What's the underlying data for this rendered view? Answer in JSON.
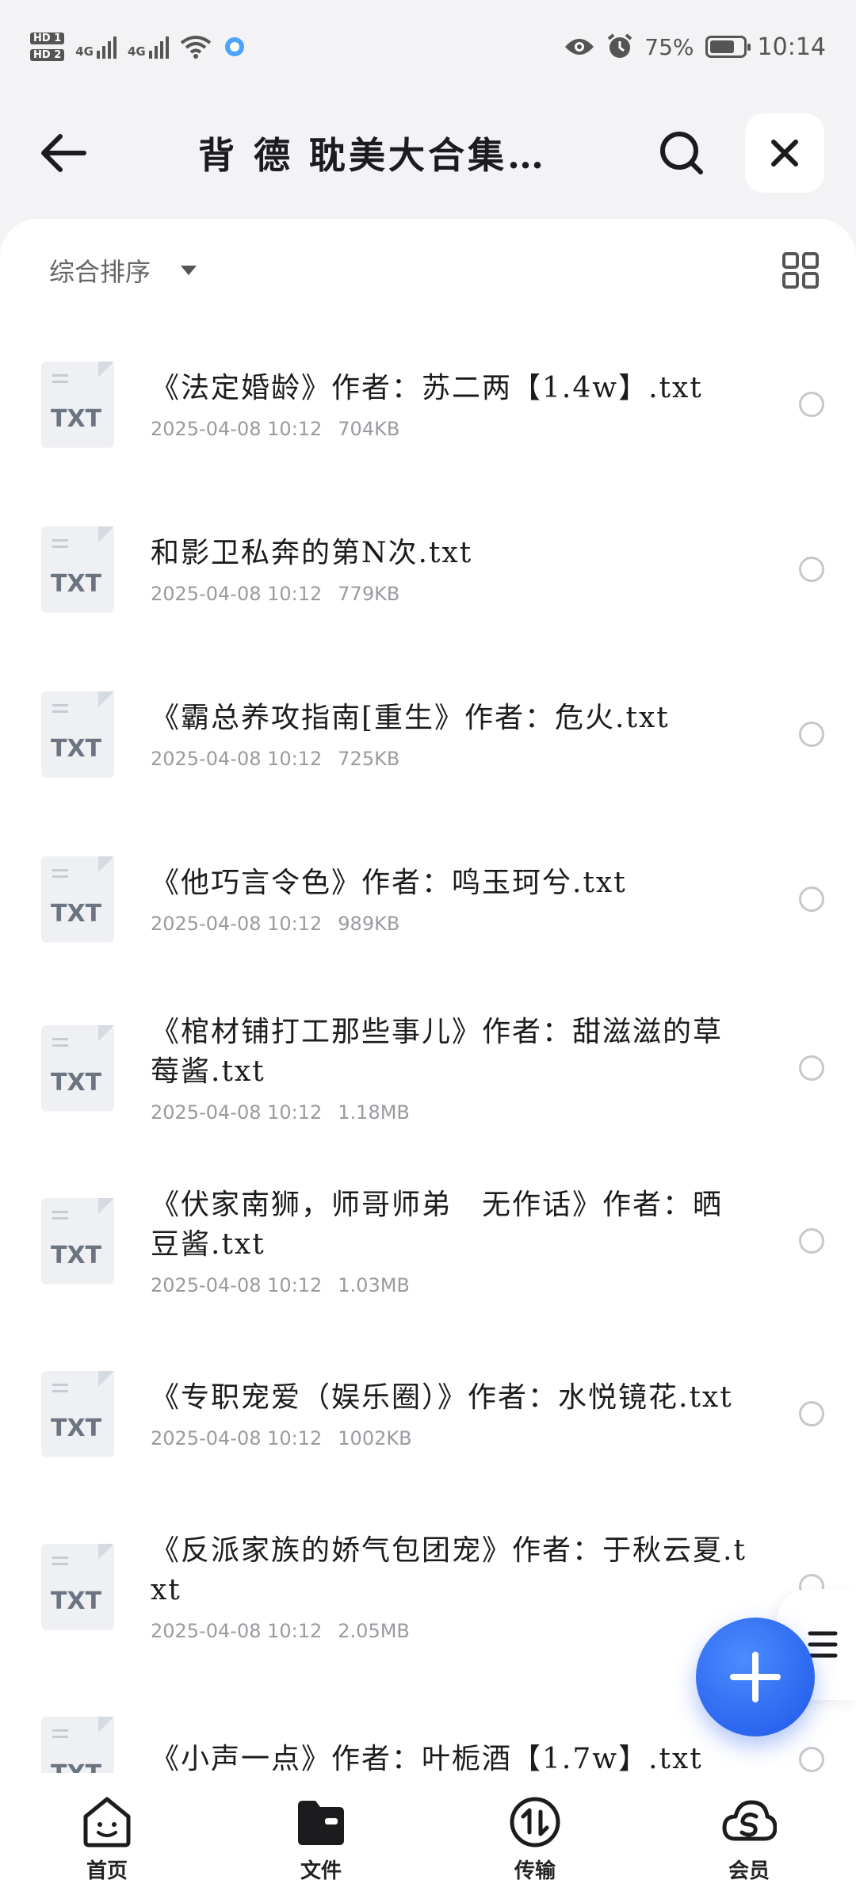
{
  "status_bar": {
    "hd1": "HD 1",
    "hd2": "HD 2",
    "net1": "4G",
    "net2": "4G",
    "battery_percent": "75%",
    "battery_level": 0.75,
    "time": "10:14"
  },
  "header": {
    "title": "背 德 耽美大合集…"
  },
  "toolbar": {
    "sort_label": "综合排序"
  },
  "files": [
    {
      "name": "《法定婚龄》作者：苏二两【1.4w】.txt",
      "date": "2025-04-08 10:12",
      "size": "704KB",
      "ext": "TXT"
    },
    {
      "name": "和影卫私奔的第N次.txt",
      "date": "2025-04-08 10:12",
      "size": "779KB",
      "ext": "TXT"
    },
    {
      "name": "《霸总养攻指南[重生》作者：危火.txt",
      "date": "2025-04-08 10:12",
      "size": "725KB",
      "ext": "TXT"
    },
    {
      "name": "《他巧言令色》作者：鸣玉珂兮.txt",
      "date": "2025-04-08 10:12",
      "size": "989KB",
      "ext": "TXT"
    },
    {
      "name": "《棺材铺打工那些事儿》作者：甜滋滋的草莓酱.txt",
      "date": "2025-04-08 10:12",
      "size": "1.18MB",
      "ext": "TXT"
    },
    {
      "name": "《伏家南狮，师哥师弟　无作话》作者：晒豆酱.txt",
      "date": "2025-04-08 10:12",
      "size": "1.03MB",
      "ext": "TXT"
    },
    {
      "name": "《专职宠爱（娱乐圈）》作者：水悦镜花.txt",
      "date": "2025-04-08 10:12",
      "size": "1002KB",
      "ext": "TXT"
    },
    {
      "name": "《反派家族的娇气包团宠》作者：于秋云夏.txt",
      "date": "2025-04-08 10:12",
      "size": "2.05MB",
      "ext": "TXT"
    },
    {
      "name": "《小声一点》作者：叶栀酒【1.7w】.txt",
      "date": "",
      "size": "",
      "ext": "TXT"
    }
  ],
  "nav": {
    "home": "首页",
    "files": "文件",
    "transfer": "传输",
    "vip": "会员"
  },
  "colors": {
    "accent": "#1e56e8",
    "background": "#f3f3f5"
  }
}
